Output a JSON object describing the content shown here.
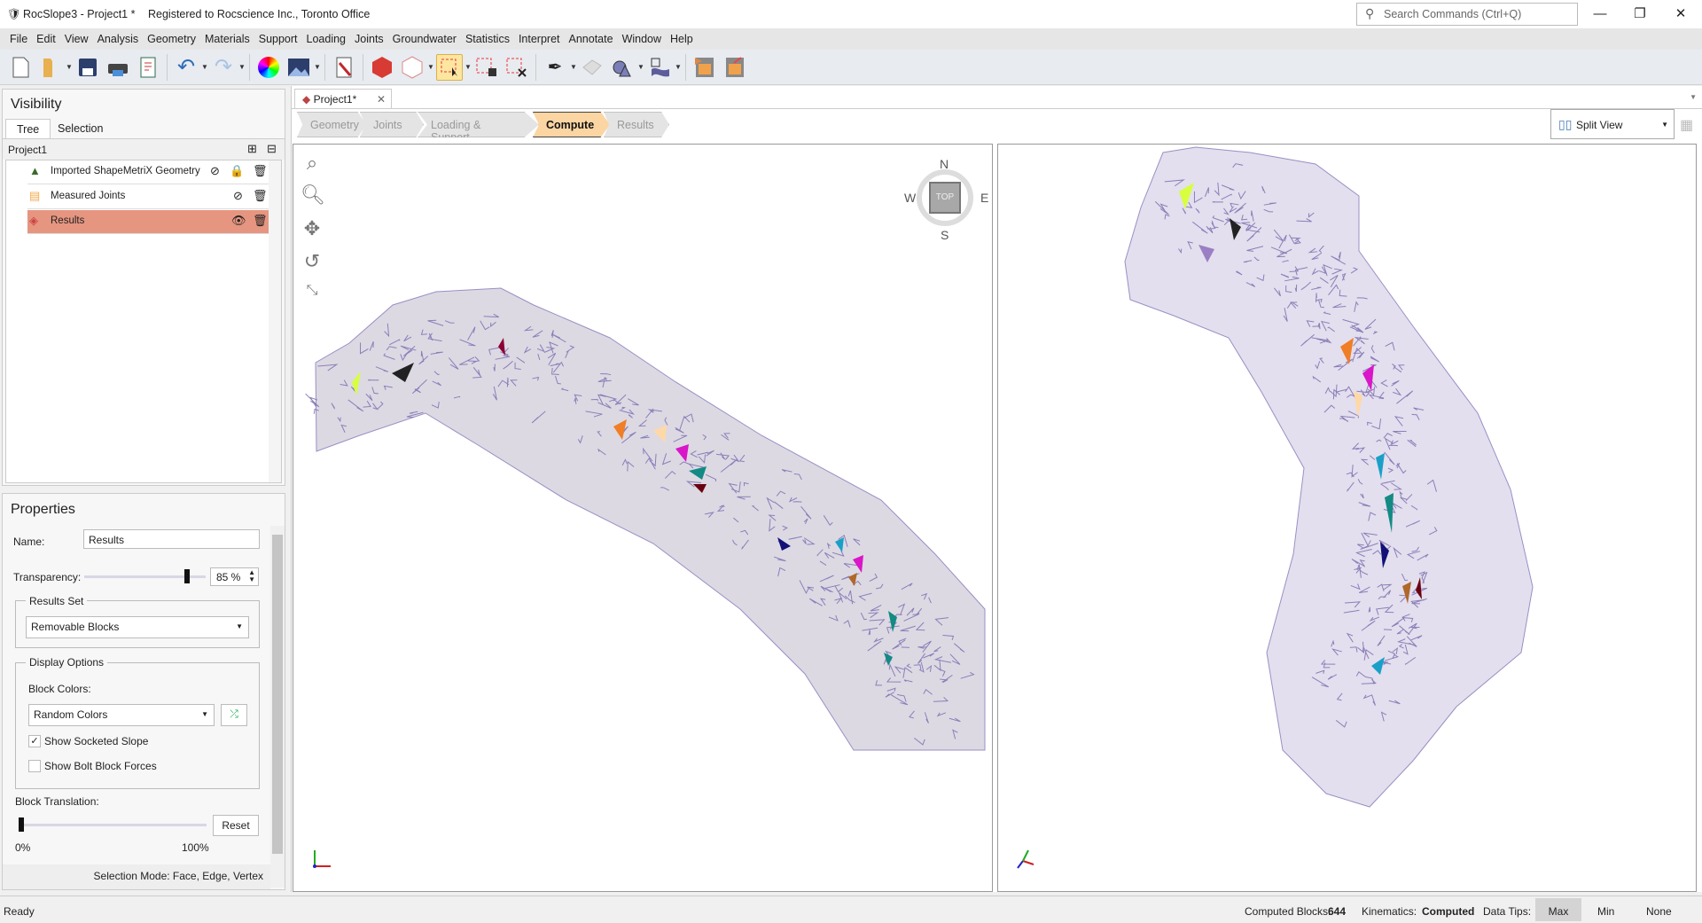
{
  "window": {
    "title": "RocSlope3 - Project1 *",
    "registration": "Registered to Rocscience Inc., Toronto Office",
    "search_placeholder": "Search Commands (Ctrl+Q)",
    "minimize": "—",
    "restore": "❐",
    "close": "✕"
  },
  "menu": [
    "File",
    "Edit",
    "View",
    "Analysis",
    "Geometry",
    "Materials",
    "Support",
    "Loading",
    "Joints",
    "Groundwater",
    "Statistics",
    "Interpret",
    "Annotate",
    "Window",
    "Help"
  ],
  "visibility": {
    "title": "Visibility",
    "tabs": [
      "Tree",
      "Selection"
    ],
    "root": "Project1",
    "items": [
      {
        "label": "Imported ShapeMetriX Geometry",
        "visible": false,
        "locked": true
      },
      {
        "label": "Measured Joints",
        "visible": false
      },
      {
        "label": "Results",
        "visible": true,
        "selected": true
      }
    ]
  },
  "properties": {
    "title": "Properties",
    "name_label": "Name:",
    "name_value": "Results",
    "transparency_label": "Transparency:",
    "transparency_value": "85 %",
    "transparency_percent": 85,
    "results_set_label": "Results Set",
    "results_set_value": "Removable Blocks",
    "display_options_label": "Display Options",
    "block_colors_label": "Block Colors:",
    "block_colors_value": "Random Colors",
    "show_socketed_slope": "Show Socketed Slope",
    "show_socketed_slope_checked": true,
    "show_bolt_forces": "Show Bolt Block Forces",
    "show_bolt_forces_checked": false,
    "block_translation_label": "Block Translation:",
    "block_translation_percent": 0,
    "reset": "Reset",
    "min": "0%",
    "max": "100%",
    "selection_mode": "Selection Mode: Face, Edge, Vertex"
  },
  "document": {
    "tab": "Project1*",
    "tab_close": "✕",
    "workflow": [
      "Geometry",
      "Joints",
      "Loading & Support",
      "Compute",
      "Results"
    ],
    "active_step": "Compute",
    "view_mode": "Split View"
  },
  "compass": {
    "n": "N",
    "s": "S",
    "e": "E",
    "w": "W",
    "top": "TOP"
  },
  "status": {
    "ready": "Ready",
    "computed_blocks_label": "Computed Blocks:",
    "computed_blocks": "644",
    "kinematics_label": "Kinematics:",
    "kinematics": "Computed",
    "data_tips_label": "Data Tips:",
    "tips": [
      "Max",
      "Min",
      "None"
    ],
    "active_tip": "Max"
  },
  "colors": {
    "accent": "#fbd5a2",
    "selected_row": "#e69580",
    "geometry_fill": "#ddd9e6",
    "joint_lines": "#8b7fb8"
  }
}
